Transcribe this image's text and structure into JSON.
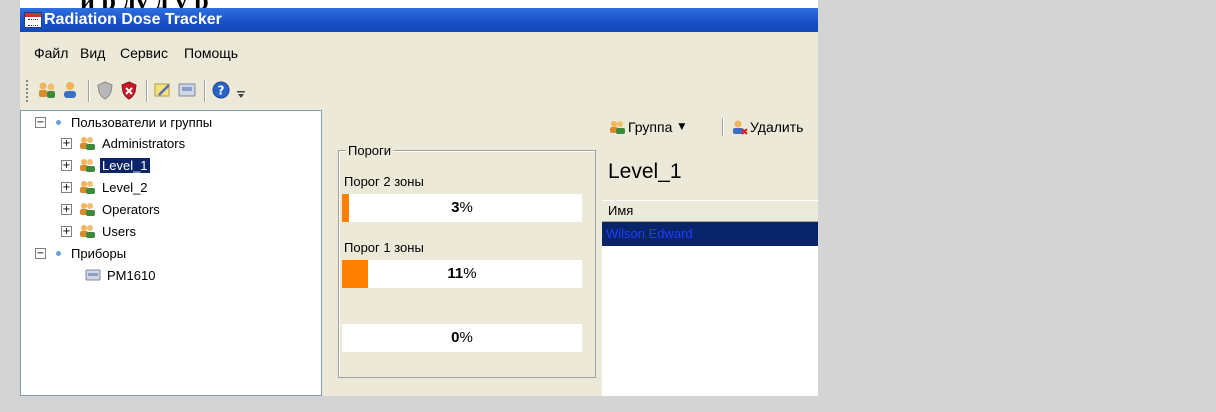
{
  "overlay": {
    "crop_text": "и      р      ду       д       у        р"
  },
  "window": {
    "title": "Radiation Dose Tracker"
  },
  "menu": [
    "Файл",
    "Вид",
    "Сервис",
    "Помощь"
  ],
  "toolbar": {
    "icons": [
      "add-user-group-icon",
      "add-user-icon",
      "shield-icon",
      "shield-delete-icon",
      "edit-icon",
      "device-icon",
      "help-icon",
      "overflow-chevron-icon"
    ]
  },
  "tree": {
    "root_users": "Пользователи и группы",
    "groups": [
      "Administrators",
      "Level_1",
      "Level_2",
      "Operators",
      "Users"
    ],
    "selected_group": "Level_1",
    "root_devices": "Приборы",
    "devices": [
      "PM1610"
    ]
  },
  "thresholds": {
    "legend": "Пороги",
    "zone2": {
      "label": "Порог 2 зоны",
      "value": 3,
      "display": "3",
      "unit": "%"
    },
    "zone1": {
      "label": "Порог 1 зоны",
      "value": 11,
      "display": "11",
      "unit": "%"
    },
    "zone0": {
      "label": "",
      "value": 0,
      "display": "0",
      "unit": "%"
    },
    "fill_color": "#ff7f00"
  },
  "right": {
    "group_button": "Группа",
    "delete_button": "Удалить",
    "group_title": "Level_1",
    "column_name": "Имя",
    "selected_row": "Wilson Edward"
  }
}
